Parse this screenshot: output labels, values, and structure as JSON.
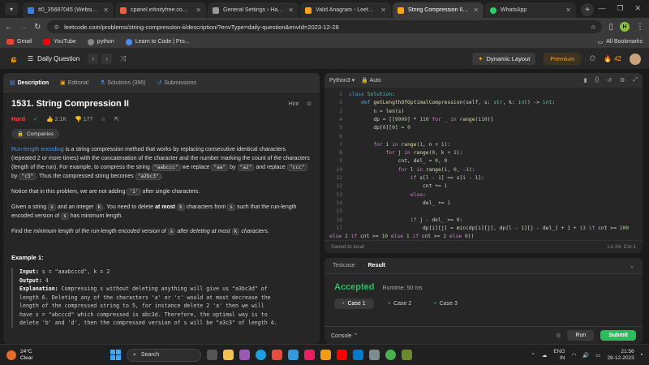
{
  "browser": {
    "tabs": [
      {
        "title": "#0_35687045 (Website for",
        "color": "#3d7ee0",
        "active": false
      },
      {
        "title": "cpanel.infinityfree.com/pa",
        "color": "#e8643a",
        "active": false
      },
      {
        "title": "General Settings ‹ Harry tr",
        "color": "#9a9a9a",
        "active": false
      },
      {
        "title": "Valid Anagram - LeetCode",
        "color": "#ffa116",
        "active": false
      },
      {
        "title": "String Compression II - Le",
        "color": "#ffa116",
        "active": true
      },
      {
        "title": "WhatsApp",
        "color": "#25d366",
        "active": false
      }
    ],
    "url": "leetcode.com/problems/string-compression-ii/description/?envType=daily-question&envId=2023-12-28",
    "profile_initial": "H",
    "bookmarks": [
      {
        "label": "Gmail",
        "color": "#ea4335"
      },
      {
        "label": "YouTube",
        "color": "#ff0000"
      },
      {
        "label": "python",
        "color": "#888888"
      },
      {
        "label": "Learn to Code | Pro...",
        "color": "#4b8bf4"
      }
    ],
    "all_bookmarks": "All Bookmarks"
  },
  "lc": {
    "title": "Daily Question",
    "dynamic_layout": "Dynamic Layout",
    "premium": "Premium",
    "streak": "42"
  },
  "problem": {
    "tabs": [
      "Description",
      "Editorial",
      "Solutions (396)",
      "Submissions"
    ],
    "title": "1531. String Compression II",
    "hint": "Hint",
    "difficulty": "Hard",
    "likes": "2.1K",
    "dislikes": "177",
    "companies": "Companies",
    "p1_link": "Run-length encoding",
    "p1_text": " is a string compression method that works by replacing consecutive identical characters (repeated 2 or more times) with the concatenation of the character and the number marking the count of the characters (length of the run). For example, to compress the string ",
    "p1_c1": "\"aabccc\"",
    "p1_t2": " we replace ",
    "p1_c2": "\"aa\"",
    "p1_t3": " by ",
    "p1_c3": "\"a2\"",
    "p1_t4": " and replace ",
    "p1_c4": "\"ccc\"",
    "p1_t5": " by ",
    "p1_c5": "\"c3\"",
    "p1_t6": ". Thus the compressed string becomes ",
    "p1_c6": "\"a2bc3\"",
    "p1_t7": ".",
    "p2_a": "Notice that in this problem, we are not adding ",
    "p2_c": "'1'",
    "p2_b": " after single characters.",
    "p3_a": "Given a string ",
    "p3_s": "s",
    "p3_b": " and an integer ",
    "p3_k": "k",
    "p3_c": ". You need to delete ",
    "p3_bold": "at most",
    "p3_k2": "k",
    "p3_d": " characters from ",
    "p3_s2": "s",
    "p3_e": " such that the run-length encoded version of ",
    "p3_s3": "s",
    "p3_f": " has minimum length.",
    "p4_a": "Find the ",
    "p4_i": "minimum length of the run-length encoded version of",
    "p4_s": "s",
    "p4_b": " after deleting at most ",
    "p4_k": "k",
    "p4_c": " characters.",
    "example_title": "Example 1:",
    "ex_input_label": "Input:",
    "ex_input": " s = \"aaabcccd\", k = 2",
    "ex_output_label": "Output:",
    "ex_output": " 4",
    "ex_expl_label": "Explanation:",
    "ex_expl_1": " Compressing s without deleting anything will give us \"a3bc3d\" of",
    "ex_expl_2": "length 6. Deleting any of the characters 'a' or 'c' would at most decrease the",
    "ex_expl_3": "length of the compressed string to 5, for instance delete 2 'a' then we will",
    "ex_expl_4": "have s = \"abcccd\" which compressed is abc3d. Therefore, the optimal way is to",
    "ex_expl_5": "delete 'b' and 'd', then the compressed version of s will be \"a3c3\" of length 4."
  },
  "editor": {
    "language": "Python3",
    "mode": "Auto",
    "line_numbers": [
      "1",
      "2",
      "3",
      "4",
      "5",
      "6",
      "7",
      "8",
      "9",
      "10",
      "11",
      "12",
      "13",
      "14",
      "15",
      "16",
      "17",
      "",
      "18",
      "19"
    ],
    "saved": "Saved to local",
    "cursor": "Ln 24, Col 1"
  },
  "console": {
    "tabs": [
      "Testcase",
      "Result"
    ],
    "status": "Accepted",
    "runtime": "Runtime: 50 ms",
    "cases": [
      "Case 1",
      "Case 2",
      "Case 3"
    ],
    "console_label": "Console",
    "run": "Run",
    "submit": "Submit"
  },
  "taskbar": {
    "temp": "24°C",
    "weather": "Clear",
    "search": "Search",
    "lang": "ENG",
    "region": "IN",
    "time": "21:56",
    "date": "28-12-2023"
  }
}
